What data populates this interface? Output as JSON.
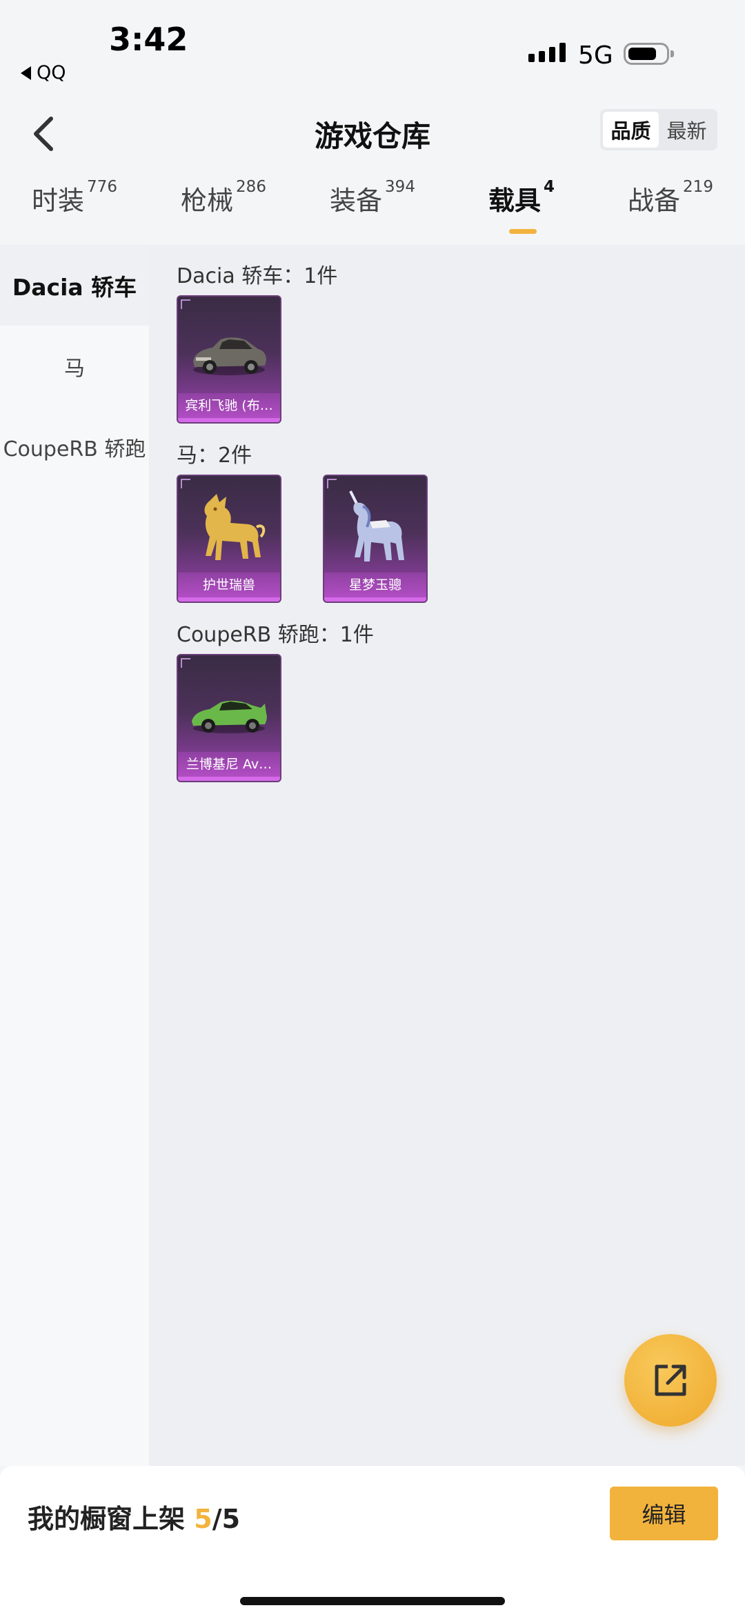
{
  "status_bar": {
    "time": "3:42",
    "back_app": "QQ",
    "network": "5G"
  },
  "header": {
    "title": "游戏仓库",
    "sort_options": [
      "品质",
      "最新"
    ],
    "sort_selected": "品质"
  },
  "tabs": [
    {
      "label": "时装",
      "count": "776"
    },
    {
      "label": "枪械",
      "count": "286"
    },
    {
      "label": "装备",
      "count": "394"
    },
    {
      "label": "载具",
      "count": "4",
      "active": true
    },
    {
      "label": "战备",
      "count": "219"
    }
  ],
  "sidebar": {
    "items": [
      "Dacia 轿车",
      "马",
      "CoupeRB 轿跑"
    ],
    "selected": "Dacia 轿车"
  },
  "sections": [
    {
      "title": "Dacia 轿车：1件",
      "items": [
        {
          "name": "宾利飞驰 (布…",
          "icon": "sedan-icon"
        }
      ]
    },
    {
      "title": "马：2件",
      "items": [
        {
          "name": "护世瑞兽",
          "icon": "golden-beast-icon"
        },
        {
          "name": "星梦玉骢",
          "icon": "unicorn-icon"
        }
      ]
    },
    {
      "title": "CoupeRB 轿跑：1件",
      "items": [
        {
          "name": "兰博基尼 Av…",
          "icon": "sports-car-icon"
        }
      ]
    }
  ],
  "share_button": {
    "icon": "share-external-icon"
  },
  "bottom_bar": {
    "label": "我的橱窗上架",
    "current": "5",
    "total": "/5",
    "edit_label": "编辑"
  },
  "colors": {
    "accent": "#f2b33d",
    "card_purple": "#7b3b8d"
  }
}
